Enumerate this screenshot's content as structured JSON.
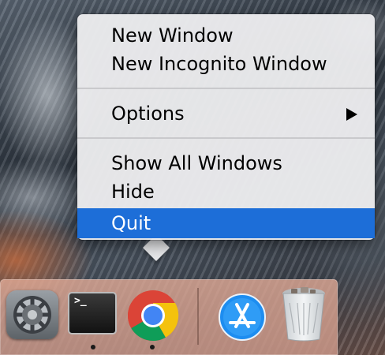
{
  "context_menu": {
    "items": [
      {
        "label": "New Window",
        "selected": false
      },
      {
        "label": "New Incognito Window",
        "selected": false
      },
      {
        "label": "Options",
        "selected": false,
        "has_submenu": true
      },
      {
        "label": "Show All Windows",
        "selected": false
      },
      {
        "label": "Hide",
        "selected": false
      },
      {
        "label": "Quit",
        "selected": true
      }
    ],
    "selection_color": "#1d6ed8"
  },
  "dock": {
    "apps": [
      {
        "name": "System Preferences",
        "icon": "gear-icon",
        "running": false
      },
      {
        "name": "Terminal",
        "icon": "terminal-icon",
        "running": true,
        "prompt_text": ">_"
      },
      {
        "name": "Google Chrome",
        "icon": "chrome-icon",
        "running": true
      },
      {
        "name": "App Store",
        "icon": "app-store-icon",
        "running": false
      },
      {
        "name": "Trash",
        "icon": "trash-icon",
        "running": false
      }
    ]
  }
}
